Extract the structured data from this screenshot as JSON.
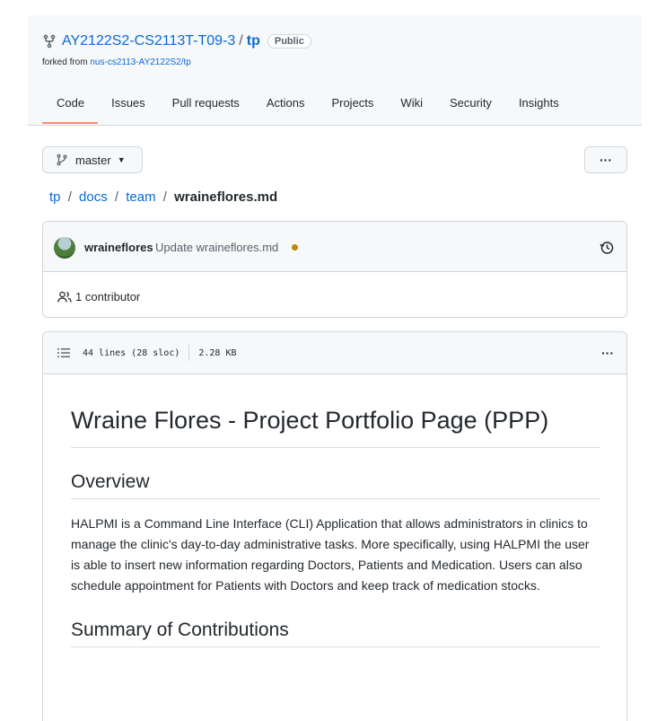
{
  "repo": {
    "owner": "AY2122S2-CS2113T-T09-3",
    "separator": "/",
    "name": "tp",
    "visibility": "Public",
    "forked_prefix": "forked from",
    "forked_source": "nus-cs2113-AY2122S2/tp"
  },
  "tabs": [
    {
      "label": "Code",
      "active": true
    },
    {
      "label": "Issues"
    },
    {
      "label": "Pull requests"
    },
    {
      "label": "Actions"
    },
    {
      "label": "Projects"
    },
    {
      "label": "Wiki"
    },
    {
      "label": "Security"
    },
    {
      "label": "Insights"
    }
  ],
  "branch": {
    "label": "master"
  },
  "more_label": "···",
  "breadcrumb": {
    "root": "tp",
    "docs": "docs",
    "team": "team",
    "sep": "/",
    "file": "wraineflores.md"
  },
  "commit": {
    "author": "wraineflores",
    "message": "Update wraineflores.md",
    "status_color": "#bf8700",
    "contributors": "1 contributor"
  },
  "file_info": {
    "lines": "44 lines (28 sloc)",
    "size": "2.28 KB"
  },
  "markdown": {
    "title": "Wraine Flores - Project Portfolio Page (PPP)",
    "overview_heading": "Overview",
    "overview_text": "HALPMI is a Command Line Interface (CLI) Application that allows administrators in clinics to manage the clinic's day-to-day administrative tasks. More specifically, using HALPMI the user is able to insert new information regarding Doctors, Patients and Medication. Users can also schedule appointment for Patients with Doctors and keep track of medication stocks.",
    "summary_heading": "Summary of Contributions"
  },
  "colors": {
    "link": "#0969da",
    "active_tab_underline": "#fd8c73",
    "border": "#d0d7de",
    "header_bg": "#f6f8fa"
  },
  "icons": [
    "fork-icon",
    "branch-icon",
    "caret-down-icon",
    "history-icon",
    "people-icon",
    "list-icon",
    "kebab-icon",
    "avatar"
  ]
}
